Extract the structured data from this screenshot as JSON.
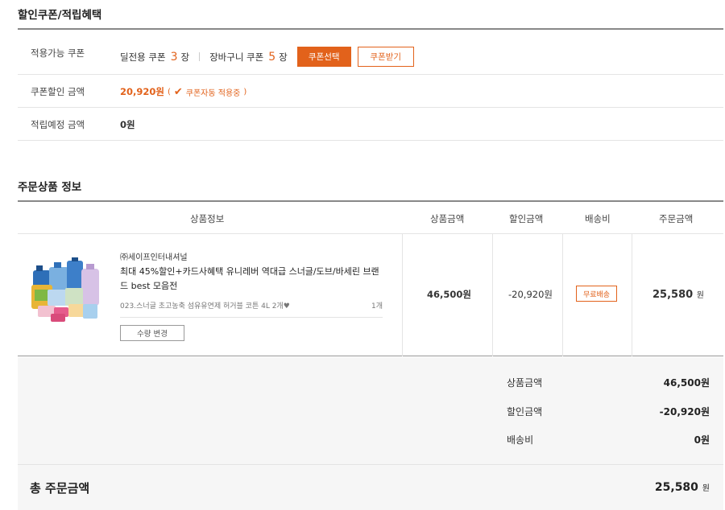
{
  "benefit": {
    "title": "할인쿠폰/적립혜택",
    "applicable": {
      "label": "적용가능 쿠폰",
      "deal_label": "딜전용 쿠폰",
      "deal_count": "3",
      "cart_label": "장바구니 쿠폰",
      "cart_count": "5",
      "unit": "장",
      "select_btn": "쿠폰선택",
      "receive_btn": "쿠폰받기"
    },
    "discount": {
      "label": "쿠폰할인 금액",
      "amount": "20,920원",
      "paren_open": "(",
      "note": "쿠폰자동 적용중",
      "paren_close": ")"
    },
    "points": {
      "label": "적립예정 금액",
      "amount": "0원"
    }
  },
  "order": {
    "title": "주문상품 정보",
    "headers": {
      "info": "상품정보",
      "price": "상품금액",
      "discount": "할인금액",
      "shipping": "배송비",
      "order": "주문금액"
    },
    "item": {
      "seller": "㈜세이프인터내셔널",
      "name": "최대 45%할인+카드사혜택 유니레버 역대급 스너글/도브/바세린 브랜드 best 모음전",
      "option": "023.스너글 초고농축 섬유유연제 허거블 코튼 4L 2개♥",
      "qty": "1개",
      "qty_btn": "수량 변경",
      "price": "46,500원",
      "discount": "-20,920원",
      "shipping_badge": "무료배송",
      "order_amount": "25,580",
      "order_unit": "원"
    },
    "summary": {
      "price_label": "상품금액",
      "price": "46,500원",
      "discount_label": "할인금액",
      "discount": "-20,920원",
      "shipping_label": "배송비",
      "shipping": "0원"
    },
    "total": {
      "label": "총 주문금액",
      "amount": "25,580",
      "unit": "원"
    }
  },
  "colors": {
    "accent": "#e2621b"
  },
  "icons": [
    "check-icon",
    "product-image"
  ]
}
